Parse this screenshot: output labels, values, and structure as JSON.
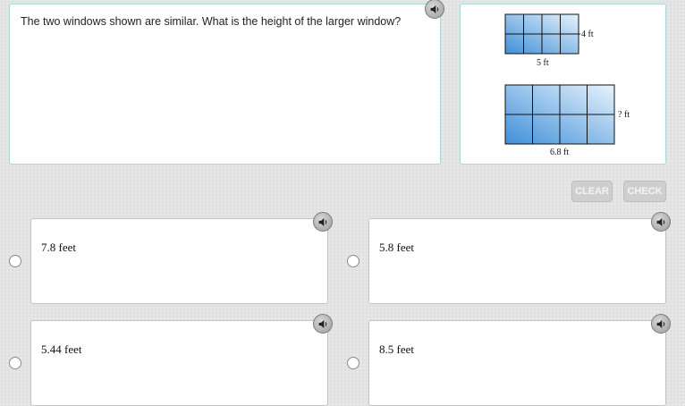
{
  "question": {
    "text": "The two windows shown are similar. What is the height of the larger window?"
  },
  "figure": {
    "small_window": {
      "height_label": "4 ft",
      "width_label": "5 ft"
    },
    "large_window": {
      "height_label": "? ft",
      "width_label": "6.8 ft"
    }
  },
  "buttons": {
    "clear": "CLEAR",
    "check": "CHECK"
  },
  "choices": [
    {
      "label": "7.8 feet"
    },
    {
      "label": "5.8 feet"
    },
    {
      "label": "5.44 feet"
    },
    {
      "label": "8.5 feet"
    }
  ],
  "colors": {
    "panel_border": "#a8d8dc",
    "button_disabled": "#cfcfcf",
    "window_blue": "#6aaee5"
  }
}
